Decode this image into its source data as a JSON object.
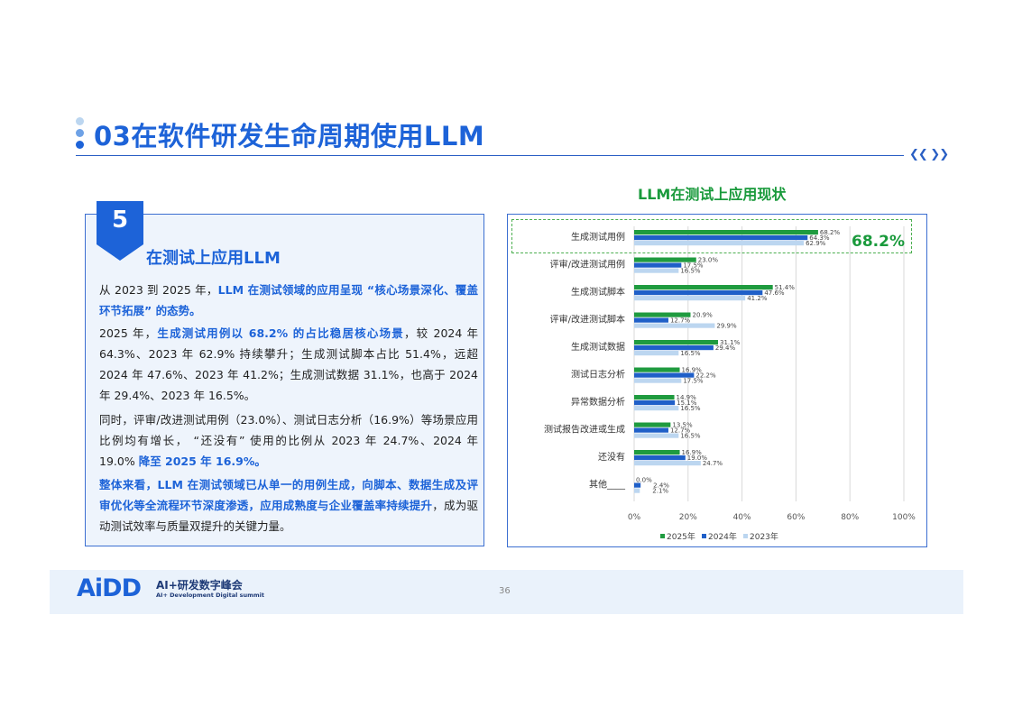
{
  "header": {
    "title": "03在软件研发生命周期使用LLM",
    "nav_icon": "double-chevron-icon"
  },
  "section": {
    "number": "5",
    "title": "在测试上应用LLM"
  },
  "paragraphs": [
    [
      {
        "t": "从 2023 到 2025 年，",
        "b": false
      },
      {
        "t": "LLM 在测试领域的应用呈现 “核心场景深化、覆盖环节拓展” 的态势。",
        "b": true
      }
    ],
    [
      {
        "t": "2025 年，",
        "b": false
      },
      {
        "t": "生成测试用例以 68.2% 的占比稳居核心场景",
        "b": true
      },
      {
        "t": "，较 2024 年 64.3%、2023 年 62.9% 持续攀升；生成测试脚本占比 51.4%，远超 2024 年 47.6%、2023 年 41.2%；生成测试数据 31.1%，也高于 2024 年 29.4%、2023 年 16.5%。",
        "b": false
      }
    ],
    [
      {
        "t": "同时，评审/改进测试用例（23.0%）、测试日志分析（16.9%）等场景应用比例均有增长， “还没有” 使用的比例从 2023 年 24.7%、2024 年 19.0% ",
        "b": false
      },
      {
        "t": "降至 2025 年 16.9%。",
        "b": true
      }
    ],
    [
      {
        "t": "整体来看，LLM 在测试领域已从单一的用例生成，向脚本、数据生成及评审优化等全流程环节深度渗透，应用成熟度与企业覆盖率持续提升",
        "b": true
      },
      {
        "t": "，成为驱动测试效率与质量双提升的关键力量。",
        "b": false
      }
    ]
  ],
  "chart_data": {
    "type": "bar",
    "orientation": "horizontal",
    "title": "LLM在测试上应用现状",
    "categories": [
      "生成测试用例",
      "评审/改进测试用例",
      "生成测试脚本",
      "评审/改进测试脚本",
      "生成测试数据",
      "测试日志分析",
      "异常数据分析",
      "测试报告改进或生成",
      "还没有",
      "其他____"
    ],
    "series": [
      {
        "name": "2025年",
        "color": "#1f9b3f",
        "values": [
          68.2,
          23.0,
          51.4,
          20.9,
          31.1,
          16.9,
          14.9,
          13.5,
          16.9,
          0.0
        ]
      },
      {
        "name": "2024年",
        "color": "#1f5fc8",
        "values": [
          64.3,
          17.5,
          47.6,
          12.7,
          29.4,
          22.2,
          15.1,
          12.7,
          19.0,
          2.4
        ]
      },
      {
        "name": "2023年",
        "color": "#bcd6f0",
        "values": [
          62.9,
          16.5,
          41.2,
          29.9,
          16.5,
          17.5,
          16.5,
          16.5,
          24.7,
          2.1
        ]
      }
    ],
    "xlim": [
      0,
      100
    ],
    "xticks": [
      "0%",
      "20%",
      "40%",
      "60%",
      "80%",
      "100%"
    ],
    "grid": true,
    "legend": "bottom",
    "highlight_label": "68.2%"
  },
  "footer": {
    "logo": "AiDD",
    "logo_cn": "AI+研发数字峰会",
    "logo_en": "AI+ Development Digital summit",
    "page": "36"
  }
}
